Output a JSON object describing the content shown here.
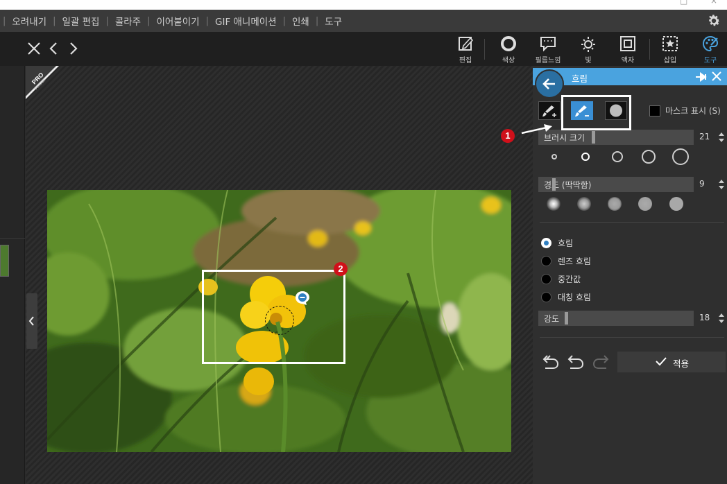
{
  "menu": {
    "items": [
      "오려내기",
      "일괄 편집",
      "콜라주",
      "이어붙이기",
      "GIF 애니메이션",
      "인쇄",
      "도구"
    ]
  },
  "toolbar": {
    "tools": [
      {
        "label": "편집",
        "icon": "edit-icon"
      },
      {
        "label": "색상",
        "icon": "color-icon"
      },
      {
        "label": "필름느낌",
        "icon": "film-icon"
      },
      {
        "label": "빛",
        "icon": "light-icon"
      },
      {
        "label": "액자",
        "icon": "frame-icon"
      },
      {
        "label": "삽입",
        "icon": "insert-icon"
      },
      {
        "label": "도구",
        "icon": "palette-icon"
      }
    ],
    "active_color": "#4aa3df"
  },
  "canvas": {
    "pro_badge_line1": "PRO",
    "pro_badge_line2": "Version",
    "annotation_1": "1",
    "annotation_2": "2"
  },
  "panel": {
    "title": "흐림",
    "mask_label": "마스크 표시 (S)",
    "brush_size": {
      "label": "브러시 크기",
      "value": "21"
    },
    "hardness": {
      "label": "경도 (딱딱함)",
      "value": "9"
    },
    "blur_types": [
      {
        "label": "흐림",
        "selected": true
      },
      {
        "label": "렌즈 흐림",
        "selected": false
      },
      {
        "label": "중간값",
        "selected": false
      },
      {
        "label": "대칭 흐림",
        "selected": false
      }
    ],
    "strength": {
      "label": "강도",
      "value": "18"
    },
    "apply_label": "적용"
  },
  "colors": {
    "accent": "#4aa3df",
    "annotation_red": "#d0101a"
  }
}
